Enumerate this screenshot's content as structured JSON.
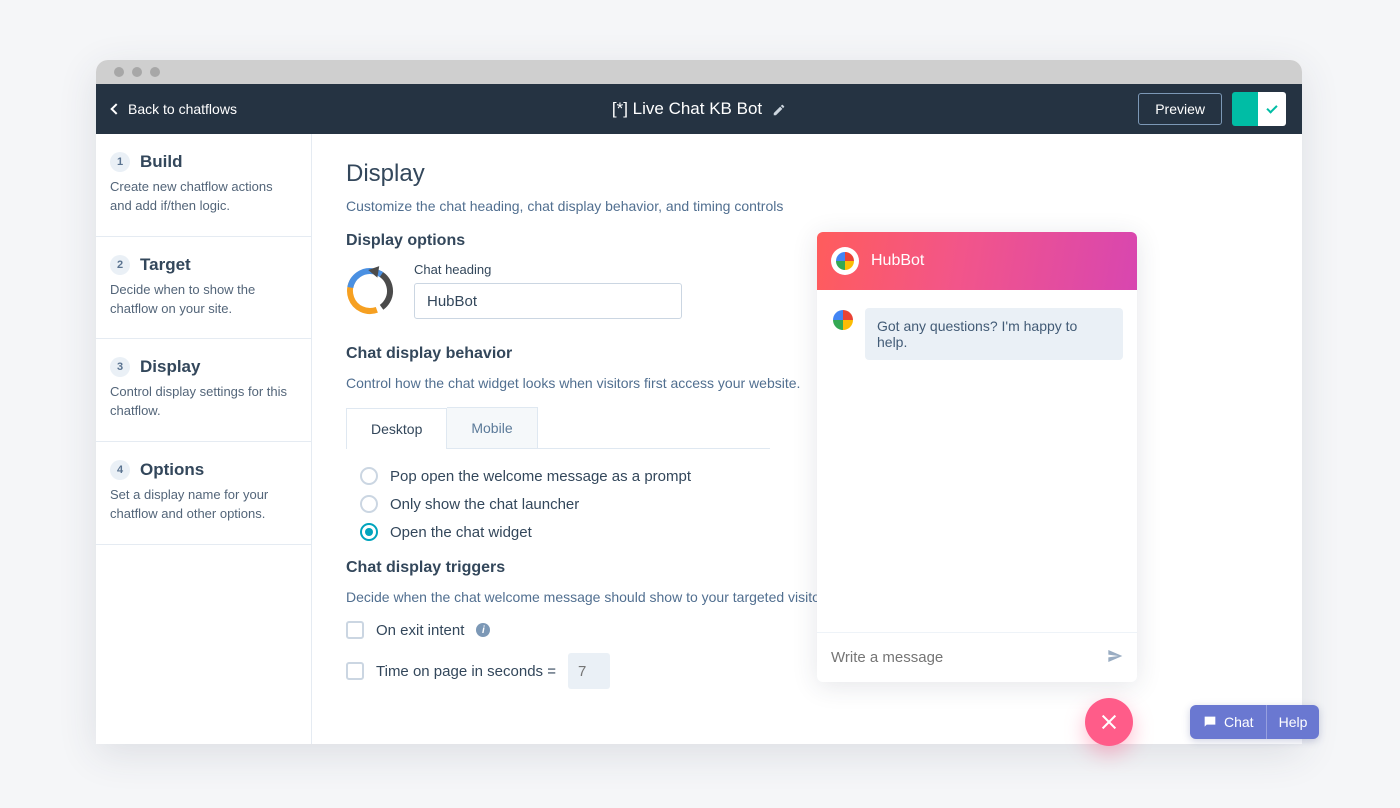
{
  "header": {
    "back_label": "Back to chatflows",
    "title": "[*] Live Chat KB Bot",
    "preview_label": "Preview"
  },
  "sidebar": {
    "items": [
      {
        "num": "1",
        "title": "Build",
        "desc": "Create new chatflow actions and add if/then logic."
      },
      {
        "num": "2",
        "title": "Target",
        "desc": "Decide when to show the chatflow on your site."
      },
      {
        "num": "3",
        "title": "Display",
        "desc": "Control display settings for this chatflow."
      },
      {
        "num": "4",
        "title": "Options",
        "desc": "Set a display name for your chatflow and other options."
      }
    ]
  },
  "main": {
    "title": "Display",
    "subtitle": "Customize the chat heading, chat display behavior, and timing controls",
    "options_heading": "Display options",
    "heading_field_label": "Chat heading",
    "heading_field_value": "HubBot",
    "behavior": {
      "heading": "Chat display behavior",
      "desc": "Control how the chat widget looks when visitors first access your website.",
      "tabs": [
        {
          "label": "Desktop",
          "active": true
        },
        {
          "label": "Mobile",
          "active": false
        }
      ],
      "radios": [
        {
          "label": "Pop open the welcome message as a prompt",
          "selected": false
        },
        {
          "label": "Only show the chat launcher",
          "selected": false
        },
        {
          "label": "Open the chat widget",
          "selected": true
        }
      ]
    },
    "triggers": {
      "heading": "Chat display triggers",
      "desc": "Decide when the chat welcome message should show to your targeted visitors.",
      "exit_intent_label": "On exit intent",
      "time_on_page_label": "Time on page in seconds =",
      "time_on_page_value": "7"
    }
  },
  "chat_preview": {
    "bot_name": "HubBot",
    "welcome_message": "Got any questions? I'm happy to help.",
    "input_placeholder": "Write a message"
  },
  "help_pill": {
    "chat_label": "Chat",
    "help_label": "Help"
  }
}
